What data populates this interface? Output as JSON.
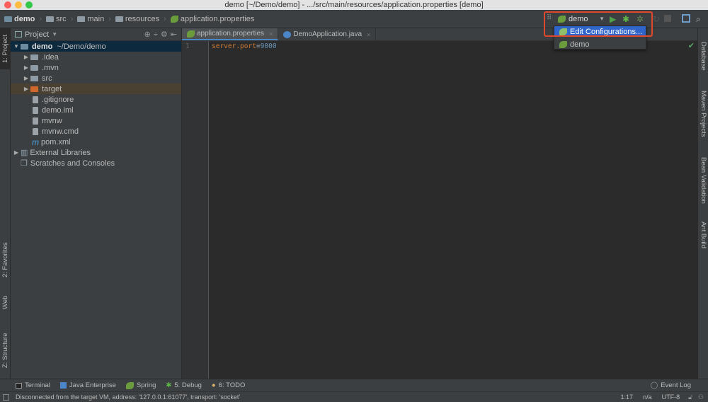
{
  "window": {
    "title": "demo [~/Demo/demo] - .../src/main/resources/application.properties [demo]"
  },
  "breadcrumb": [
    "demo",
    "src",
    "main",
    "resources",
    "application.properties"
  ],
  "run_config": {
    "selected": "demo",
    "menu": [
      "Edit Configurations...",
      "demo"
    ]
  },
  "project_panel": {
    "title": "Project",
    "tree": [
      {
        "label": "demo",
        "path": "~/Demo/demo",
        "type": "module",
        "expanded": true
      },
      {
        "label": ".idea",
        "type": "folder"
      },
      {
        "label": ".mvn",
        "type": "folder"
      },
      {
        "label": "src",
        "type": "folder"
      },
      {
        "label": "target",
        "type": "folder-excluded"
      },
      {
        "label": ".gitignore",
        "type": "file"
      },
      {
        "label": "demo.iml",
        "type": "file"
      },
      {
        "label": "mvnw",
        "type": "file"
      },
      {
        "label": "mvnw.cmd",
        "type": "file"
      },
      {
        "label": "pom.xml",
        "type": "maven"
      },
      {
        "label": "External Libraries",
        "type": "libraries"
      },
      {
        "label": "Scratches and Consoles",
        "type": "scratches"
      }
    ]
  },
  "editor": {
    "tabs": [
      "application.properties",
      "DemoApplication.java"
    ],
    "active_tab": 0,
    "lines": [
      {
        "n": "1",
        "key": "server.port",
        "eq": "=",
        "value": "9000"
      }
    ]
  },
  "left_stripe": [
    "1: Project",
    "2: Favorites",
    "Web",
    "Z: Structure"
  ],
  "right_stripe": [
    "Database",
    "Maven Projects",
    "Bean Validation",
    "Ant Build"
  ],
  "bottom_tools": [
    "Terminal",
    "Java Enterprise",
    "Spring",
    "5: Debug",
    "6: TODO"
  ],
  "event_log": "Event Log",
  "status": {
    "message": "Disconnected from the target VM, address: '127.0.0.1:61077', transport: 'socket'",
    "position": "1:17",
    "line_sep": "n/a",
    "encoding": "UTF-8"
  },
  "colors": {
    "accent": "#2f65ca",
    "highlight_box": "#e0482c",
    "key": "#cc7832",
    "value": "#6897bb"
  }
}
